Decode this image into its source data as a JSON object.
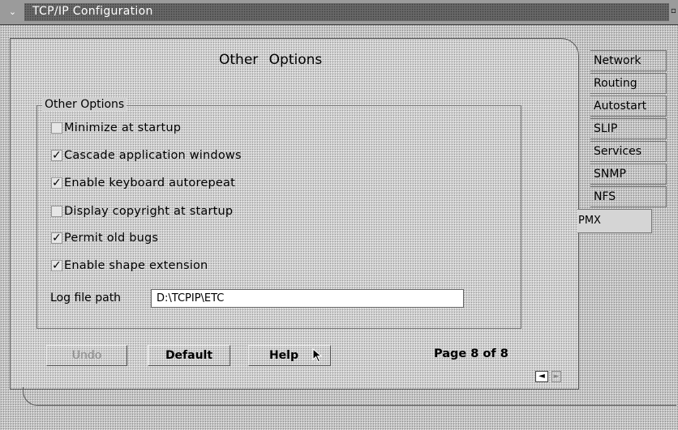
{
  "window": {
    "title": "TCP/IP Configuration"
  },
  "page": {
    "title": "Other Options"
  },
  "group": {
    "label": "Other Options",
    "options": [
      {
        "label": "Minimize at startup",
        "checked": false
      },
      {
        "label": "Cascade application windows",
        "checked": true
      },
      {
        "label": "Enable keyboard autorepeat",
        "checked": true
      },
      {
        "label": "Display copyright at startup",
        "checked": false
      },
      {
        "label": "Permit old bugs",
        "checked": true
      },
      {
        "label": "Enable shape extension",
        "checked": true
      }
    ],
    "log_file": {
      "label": "Log file path",
      "value": "D:\\TCPIP\\ETC"
    }
  },
  "buttons": {
    "undo": "Undo",
    "default": "Default",
    "help": "Help"
  },
  "pagination": {
    "text": "Page 8 of 8"
  },
  "tabs": [
    "Network",
    "Routing",
    "Autostart",
    "SLIP",
    "Services",
    "SNMP",
    "NFS"
  ],
  "active_tab": "PMX",
  "icons": {
    "check": "✓",
    "left_arrow": "◄",
    "right_arrow": "►",
    "system_menu": "⌄",
    "restore": "▫"
  }
}
